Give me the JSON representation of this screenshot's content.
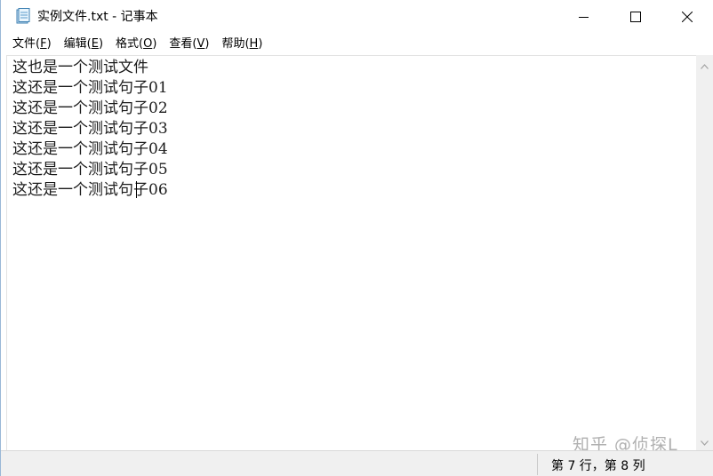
{
  "window": {
    "title": "实例文件.txt - 记事本"
  },
  "menu": [
    {
      "label": "文件(",
      "key": "F",
      "suffix": ")"
    },
    {
      "label": "编辑(",
      "key": "E",
      "suffix": ")"
    },
    {
      "label": "格式(",
      "key": "O",
      "suffix": ")"
    },
    {
      "label": "查看(",
      "key": "V",
      "suffix": ")"
    },
    {
      "label": "帮助(",
      "key": "H",
      "suffix": ")"
    }
  ],
  "editor": {
    "lines": [
      "这也是一个测试文件",
      "这还是一个测试句子01",
      "这还是一个测试句子02",
      "这还是一个测试句子03",
      "这还是一个测试句子04",
      "这还是一个测试句子05",
      "这还是一个测试句子06"
    ]
  },
  "status": {
    "position": "第 7 行，第 8 列"
  },
  "watermark": "知乎 @侦探L",
  "colors": {
    "window_border": "#9ab8d6",
    "statusbar_bg": "#f0f0f0"
  },
  "icons": {
    "app": "notepad-icon",
    "minimize": "minimize-icon",
    "maximize": "maximize-icon",
    "close": "close-icon"
  }
}
